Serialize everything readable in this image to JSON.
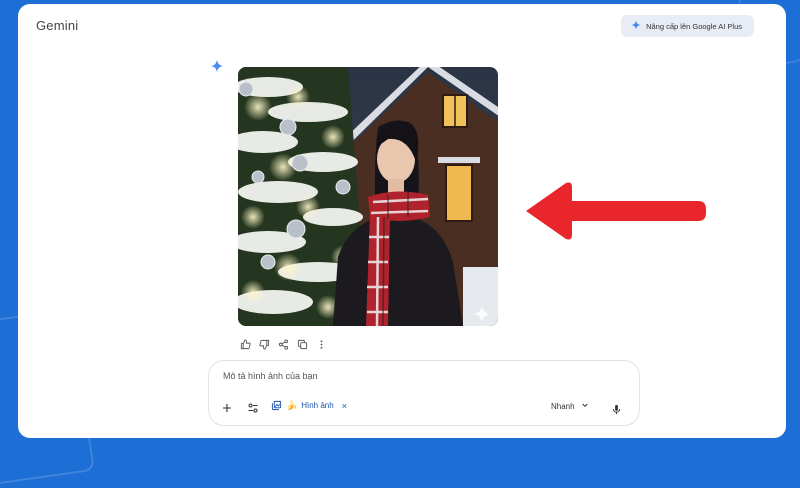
{
  "app": {
    "title": "Gemini"
  },
  "header": {
    "upgrade_label": "Nâng cấp lên Google AI Plus"
  },
  "composer": {
    "placeholder": "Mô tả hình ảnh của bạn",
    "chip_label": "Hình ảnh",
    "chip_emoji": "🍌",
    "chip_close": "×",
    "mode_label": "Nhanh"
  },
  "icons": {
    "upgrade": "sparkle-icon",
    "response": "gemini-spark-icon",
    "actions": [
      "thumbs-up-icon",
      "thumbs-down-icon",
      "share-icon",
      "copy-icon",
      "more-vert-icon"
    ],
    "composer": [
      "plus-icon",
      "tools-icon",
      "image-icon",
      "chevron-down-icon",
      "mic-icon"
    ]
  },
  "colors": {
    "background": "#1d6fd6",
    "accent": "#4285f4",
    "arrow": "#e8262c",
    "chip_text": "#1a4ea8"
  }
}
